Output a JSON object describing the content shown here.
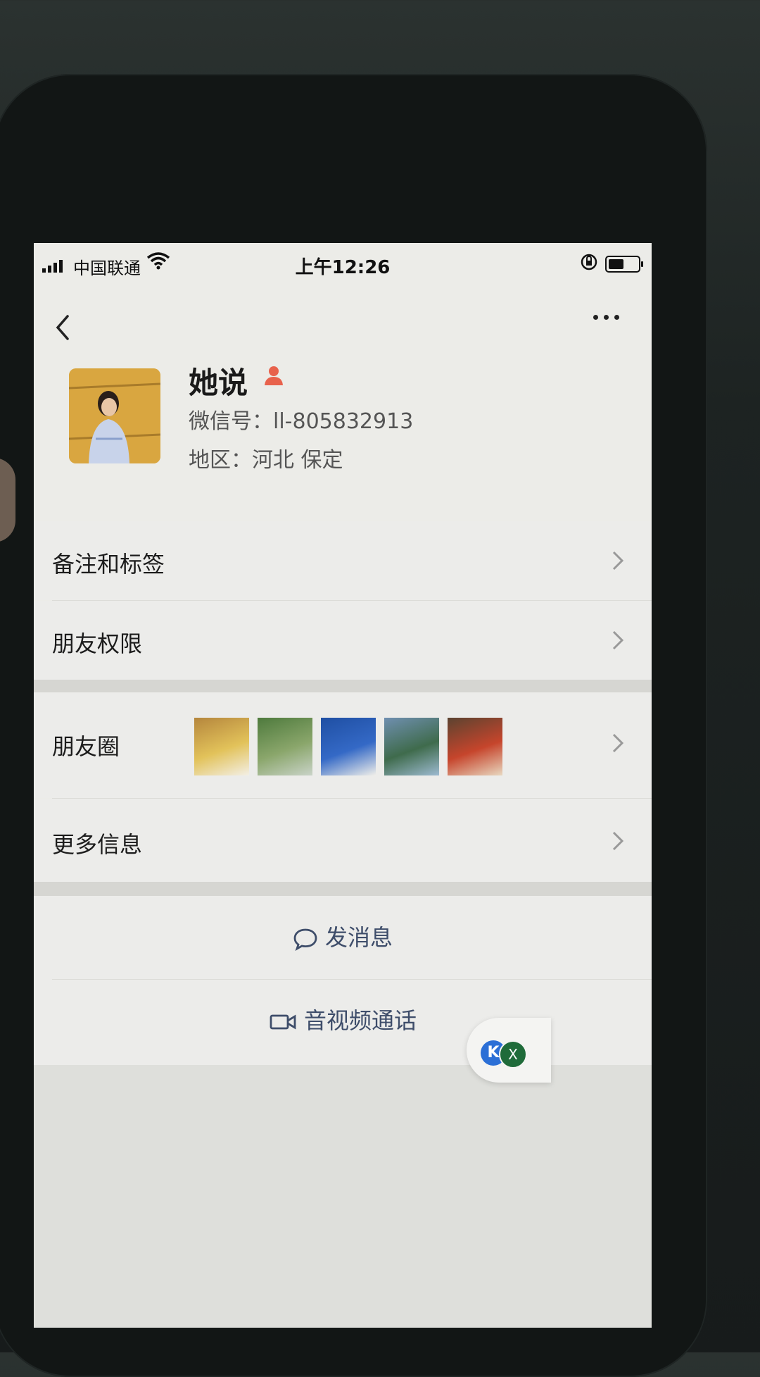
{
  "status_bar": {
    "carrier": "中国联通",
    "time": "上午12:26",
    "battery_level": 0.55
  },
  "profile": {
    "nickname": "她说",
    "wechat_id": "微信号：ll-805832913",
    "region": "地区：河北 保定"
  },
  "rows": {
    "remark_tags": "备注和标签",
    "friend_permissions": "朋友权限",
    "moments": "朋友圈",
    "more_info": "更多信息"
  },
  "actions": {
    "send_message": "发消息",
    "av_call": "音视频通话"
  },
  "moments_thumbs": [
    {
      "name": "moments-thumb-food",
      "colors": [
        "#b5863d",
        "#e2c25a",
        "#f3efe6"
      ]
    },
    {
      "name": "moments-thumb-garden",
      "colors": [
        "#4e7a3d",
        "#8aa66b",
        "#c9d3c8"
      ]
    },
    {
      "name": "moments-thumb-portrait",
      "colors": [
        "#1f4fa3",
        "#3469c6",
        "#f0efe9"
      ]
    },
    {
      "name": "moments-thumb-lake",
      "colors": [
        "#6f8fb0",
        "#3f6b4c",
        "#9dbad1"
      ]
    },
    {
      "name": "moments-thumb-dish",
      "colors": [
        "#5b4330",
        "#c6452c",
        "#e8d8c0"
      ]
    }
  ],
  "icons": {
    "back": "back-chevron-icon",
    "more": "more-dots-icon",
    "gender": "person-icon",
    "chat": "chat-bubble-icon",
    "video": "video-camera-icon",
    "chevron": "chevron-right-icon"
  },
  "colors": {
    "accent": "#3e4d6a",
    "gender_icon": "#e8624c"
  },
  "float_widget": {
    "k_label": "K",
    "x_label": "X"
  }
}
